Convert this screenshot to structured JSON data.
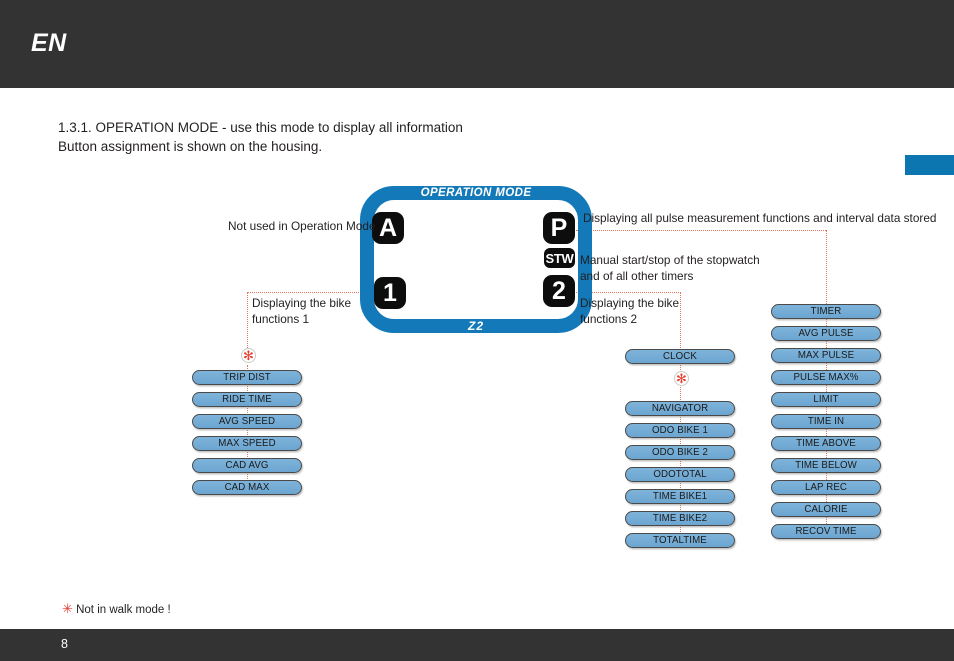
{
  "header": {
    "language_code": "EN",
    "bar_color": "#333333"
  },
  "side_tab": {
    "color": "#0B76B0"
  },
  "intro": {
    "line1": "1.3.1. OPERATION MODE - use this mode to display all information",
    "line2": "Button assignment is shown on the housing."
  },
  "diagram": {
    "ring_title": "OPERATION MODE",
    "ring_bottom_label": "Z2",
    "ring_color": "#1479B8",
    "badges": {
      "a": "A",
      "one": "1",
      "p": "P",
      "stw": "STW",
      "two": "2"
    },
    "callouts": {
      "a": "Not used in Operation Mode",
      "p": "Displaying all pulse measurement functions and interval data stored",
      "stw_line1": "Manual start/stop of the stopwatch",
      "stw_line2": "and of all other timers",
      "one_line1": "Displaying the bike",
      "one_line2": "functions 1",
      "two_line1": "Displaying the bike",
      "two_line2": "functions 2"
    },
    "asterisk_glyph": "✻",
    "connector_color": "#E8765A"
  },
  "columns": {
    "bike_functions_1": [
      "TRIP DIST",
      "RIDE TIME",
      "AVG SPEED",
      "MAX SPEED",
      "CAD AVG",
      "CAD MAX"
    ],
    "bike_functions_2_top": [
      "CLOCK"
    ],
    "bike_functions_2": [
      "NAVIGATOR",
      "ODO BIKE 1",
      "ODO BIKE 2",
      "ODOTOTAL",
      "TIME BIKE1",
      "TIME BIKE2",
      "TOTALTIME"
    ],
    "pulse_functions": [
      "TIMER",
      "AVG PULSE",
      "MAX PULSE",
      "PULSE MAX%",
      "LIMIT",
      "TIME IN",
      "TIME ABOVE",
      "TIME BELOW",
      "LAP REC",
      "CALORIE",
      "RECOV TIME"
    ]
  },
  "footnote": {
    "star": "✳",
    "text": "Not in walk mode !"
  },
  "footer": {
    "page_number": "8",
    "bar_color": "#333333"
  }
}
